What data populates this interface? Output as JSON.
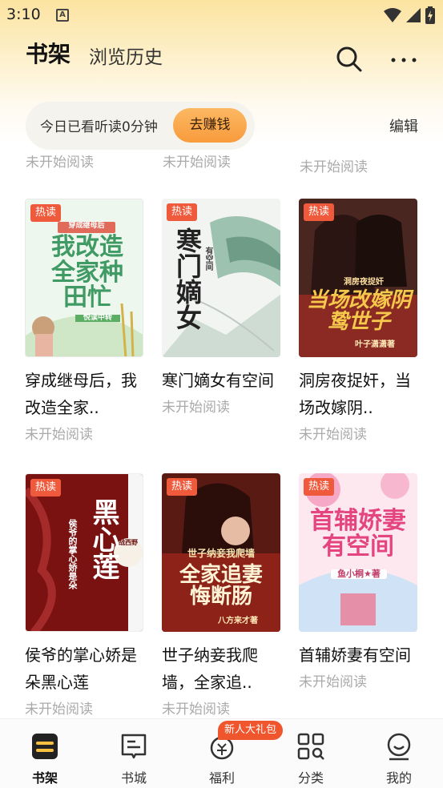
{
  "status_bar": {
    "time": "3:10",
    "notification_icon": "A"
  },
  "header": {
    "tabs": [
      {
        "label": "书架",
        "active": true
      },
      {
        "label": "浏览历史",
        "active": false
      }
    ]
  },
  "reading": {
    "summary": "今日已看听读0分钟",
    "earn_label": "去赚钱",
    "edit_label": "编辑"
  },
  "previous_row_status": [
    "未开始阅读",
    "未开始阅读",
    "未开始阅读"
  ],
  "books": [
    {
      "badge": "热读",
      "title": "穿成继母后，我改造全家..",
      "status": "未开始阅读",
      "cover_text": "我改造全家种田忙",
      "cover_top": "穿成继母后",
      "cover_bottom": "悦读中转",
      "accent": "#4aa36b"
    },
    {
      "badge": "热读",
      "title": "寒门嫡女有空间",
      "status": "未开始阅读",
      "cover_text": "寒门嫡女",
      "cover_top": "有空间",
      "cover_bottom": "",
      "accent": "#222222"
    },
    {
      "badge": "热读",
      "title": "洞房夜捉奸，当场改嫁阴..",
      "status": "未开始阅读",
      "cover_text": "当场改嫁阴鸷世子",
      "cover_top": "洞房夜捉奸",
      "cover_bottom": "叶子潇潇著",
      "accent": "#f2c94c"
    },
    {
      "badge": "热读",
      "title": "侯爷的掌心娇是朵黑心莲",
      "status": "未开始阅读",
      "cover_text": "黑心莲",
      "cover_top": "侯爷的掌心娇是朵",
      "cover_bottom": "战西野",
      "accent": "#ffffff"
    },
    {
      "badge": "热读",
      "title": "世子纳妾我爬墙，全家追..",
      "status": "未开始阅读",
      "cover_text": "全家追妻悔断肠",
      "cover_top": "世子纳妾我爬墙",
      "cover_bottom": "八方来才著",
      "accent": "#ffe9b8"
    },
    {
      "badge": "热读",
      "title": "首辅娇妻有空间",
      "status": "未开始阅读",
      "cover_text": "首辅娇妻有空间",
      "cover_top": "",
      "cover_bottom": "鱼小桐★著",
      "accent": "#e84d8a"
    }
  ],
  "bottom_nav": {
    "items": [
      {
        "label": "书架",
        "icon": "bookshelf-icon",
        "active": true
      },
      {
        "label": "书城",
        "icon": "book-store-icon",
        "active": false
      },
      {
        "label": "福利",
        "icon": "welfare-icon",
        "active": false
      },
      {
        "label": "分类",
        "icon": "category-icon",
        "active": false
      },
      {
        "label": "我的",
        "icon": "profile-icon",
        "active": false
      }
    ],
    "promo_badge": "新人大礼包"
  },
  "colors": {
    "accent_orange": "#f89b3c",
    "hot_badge": "#f05a3c",
    "promo_red": "#f0562e"
  }
}
